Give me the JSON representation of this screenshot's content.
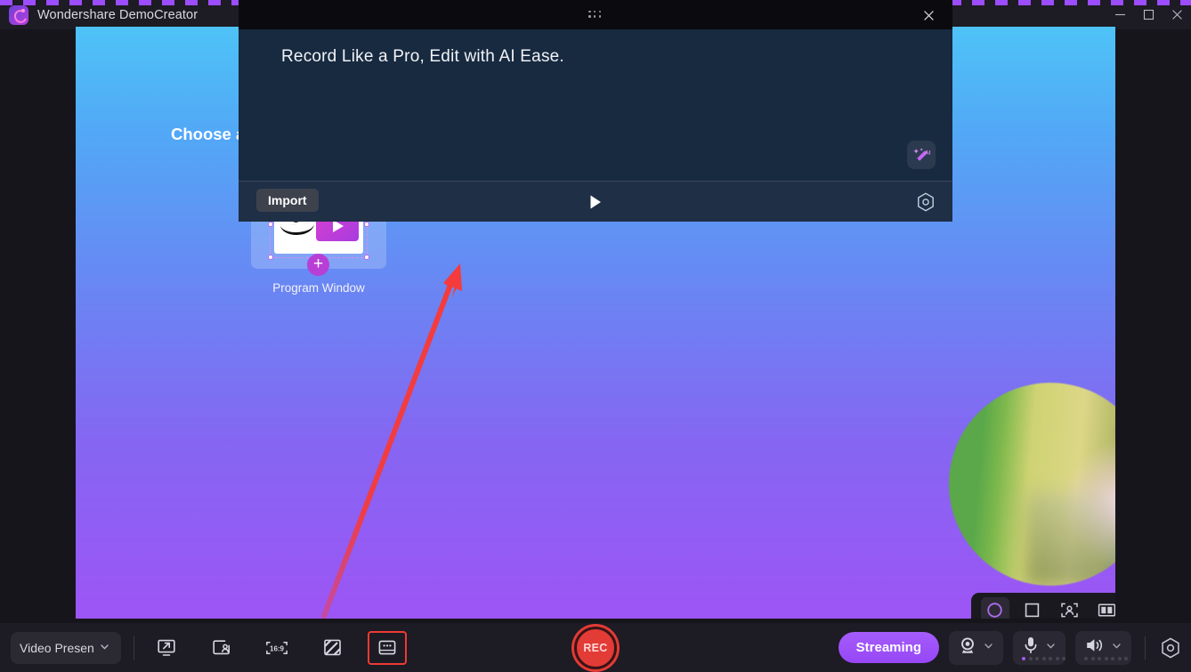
{
  "titlebar": {
    "app_title": "Wondershare DemoCreator",
    "logo_icon": "democreator-logo-icon",
    "window_controls": [
      {
        "name": "minimize",
        "icon": "minimize-icon"
      },
      {
        "name": "maximize",
        "icon": "maximize-icon"
      },
      {
        "name": "close",
        "icon": "close-icon"
      }
    ]
  },
  "canvas": {
    "chooser_heading": "Choose a program window to share",
    "program_window": {
      "label": "Program Window",
      "add_icon": "plus-icon",
      "thumbnail_icon": "program-window-thumbnail"
    },
    "import_tooltip": "Import",
    "webcam": {
      "shape": "circle",
      "toolbar": [
        {
          "name": "circle-shape",
          "icon": "circle-icon",
          "active": true
        },
        {
          "name": "square-shape",
          "icon": "square-icon",
          "active": false
        },
        {
          "name": "person-focus",
          "icon": "person-focus-icon",
          "active": false
        },
        {
          "name": "split-view",
          "icon": "split-view-icon",
          "active": false
        }
      ]
    }
  },
  "overlay": {
    "grip_icon": "drag-grip-icon",
    "close_icon": "close-icon",
    "tagline": "Record Like a Pro, Edit with AI Ease.",
    "ai_badge_icon": "ai-magic-wand-icon",
    "ai_badge_label": "AI",
    "play_icon": "play-icon",
    "settings_icon": "settings-hex-icon"
  },
  "annotation": {
    "arrow_color": "#f53b3b",
    "highlight_color": "#ef3a35"
  },
  "bottombar": {
    "mode_select": {
      "value": "Video Presenta",
      "chevron_icon": "chevron-down-icon"
    },
    "tools": [
      {
        "name": "screen-share",
        "icon": "screen-share-icon",
        "highlighted": false
      },
      {
        "name": "privacy-screen",
        "icon": "privacy-screen-icon",
        "highlighted": false
      },
      {
        "name": "aspect-ratio",
        "icon": "16-9-icon",
        "label": "16:9",
        "highlighted": false
      },
      {
        "name": "background-blur",
        "icon": "hatch-pattern-icon",
        "highlighted": false
      },
      {
        "name": "captions",
        "icon": "captions-icon",
        "highlighted": true
      }
    ],
    "record_button": {
      "label": "REC"
    },
    "streaming_button": {
      "label": "Streaming"
    },
    "devices": [
      {
        "name": "webcam",
        "icon": "webcam-icon",
        "chevron_icon": "chevron-down-icon",
        "levels_total": 0,
        "levels_on": 0
      },
      {
        "name": "microphone",
        "icon": "microphone-icon",
        "chevron_icon": "chevron-down-icon",
        "levels_total": 7,
        "levels_on": 1
      },
      {
        "name": "speaker",
        "icon": "speaker-icon",
        "chevron_icon": "chevron-down-icon",
        "levels_total": 7,
        "levels_on": 0
      }
    ],
    "settings_icon": "settings-hex-icon"
  },
  "colors": {
    "accent_purple": "#9747f5",
    "record_red": "#e33b36",
    "annotation_red": "#f53b3b",
    "canvas_top": "#4ec3f7",
    "canvas_bottom": "#9d55f5"
  }
}
